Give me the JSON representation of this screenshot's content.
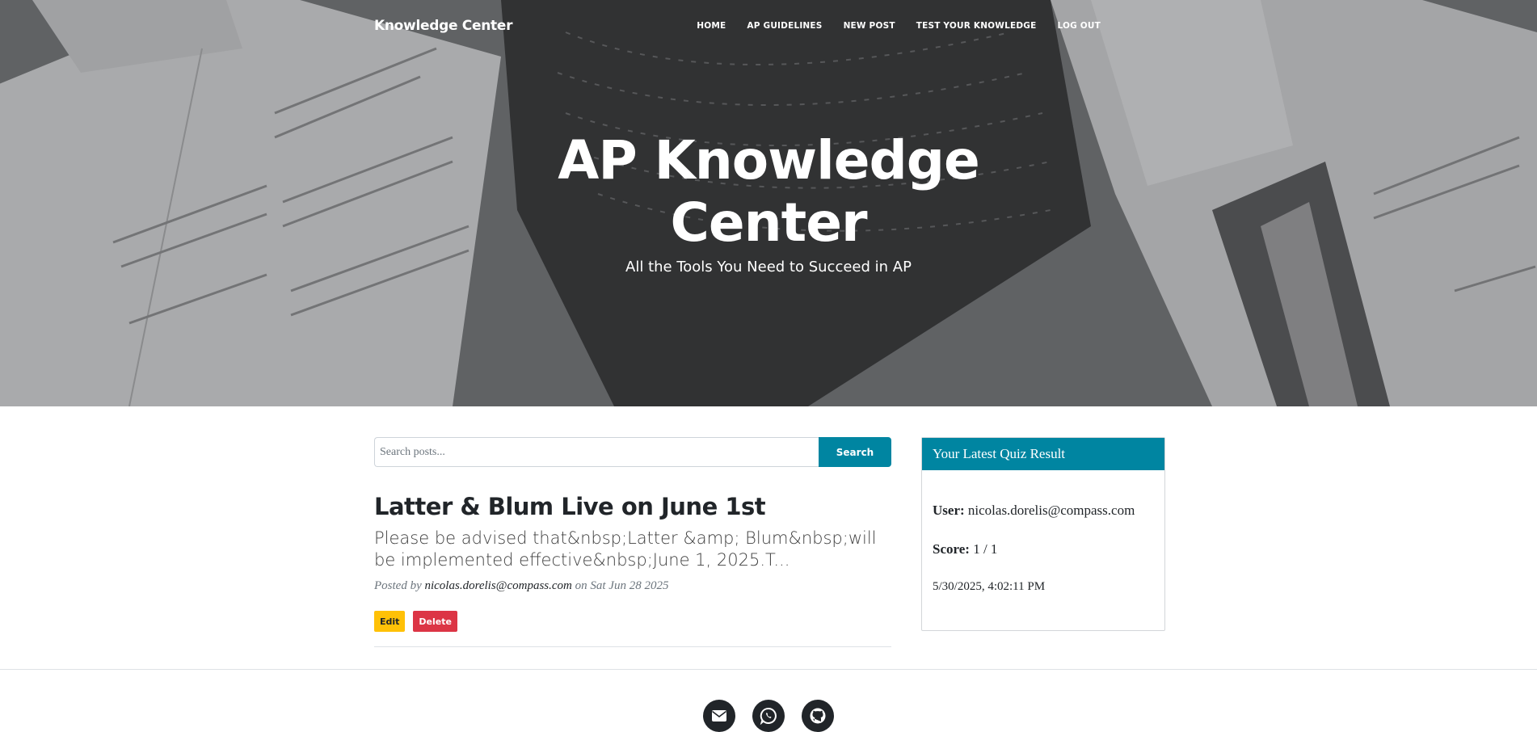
{
  "navbar": {
    "brand": "Knowledge Center",
    "links": [
      "HOME",
      "AP GUIDELINES",
      "NEW POST",
      "TEST YOUR KNOWLEDGE",
      "LOG OUT"
    ]
  },
  "hero": {
    "title_line1": "AP Knowledge",
    "title_line2": "Center",
    "subtitle": "All the Tools You Need to Succeed in AP"
  },
  "search": {
    "placeholder": "Search posts...",
    "button_label": "Search"
  },
  "post": {
    "title": "Latter & Blum Live on June 1st",
    "excerpt": "Please be advised that&nbsp;Latter &amp; Blum&nbsp;will be implemented effective&nbsp;June 1, 2025.T...",
    "meta_prefix": "Posted by",
    "author": "nicolas.dorelis@compass.com",
    "meta_on": "on Sat Jun 28 2025",
    "edit_label": "Edit",
    "delete_label": "Delete"
  },
  "quiz": {
    "header": "Your Latest Quiz Result",
    "user_label": "User:",
    "user_value": "nicolas.dorelis@compass.com",
    "score_label": "Score:",
    "score_value": "1 / 1",
    "date": "5/30/2025, 4:02:11 PM"
  },
  "footer": {
    "icons": [
      "envelope-icon",
      "whatsapp-icon",
      "github-icon"
    ]
  },
  "colors": {
    "accent": "#0085a1",
    "edit": "#ffc107",
    "delete": "#dc3545",
    "text": "#212529"
  }
}
